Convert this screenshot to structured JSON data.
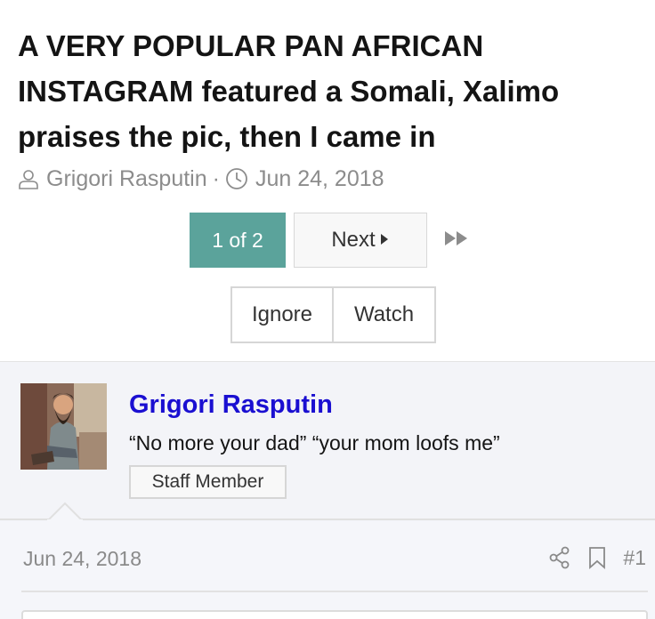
{
  "thread": {
    "title": "A VERY POPULAR PAN AFRICAN INSTAGRAM featured a Somali, Xalimo praises the pic, then I came in",
    "author": "Grigori Rasputin",
    "separator": "·",
    "date": "Jun 24, 2018"
  },
  "pagination": {
    "current_label": "1 of 2",
    "next_label": "Next",
    "accent_color": "#5ba39b"
  },
  "actions": {
    "ignore_label": "Ignore",
    "watch_label": "Watch"
  },
  "post": {
    "username": "Grigori Rasputin",
    "username_color": "#1a0fd1",
    "user_title": "“No more your dad” “your mom loofs me”",
    "badge": "Staff Member",
    "date": "Jun 24, 2018",
    "number": "#1",
    "icons": [
      "user-icon",
      "clock-icon",
      "caret-right-icon",
      "fast-forward-icon",
      "share-icon",
      "bookmark-icon"
    ]
  }
}
